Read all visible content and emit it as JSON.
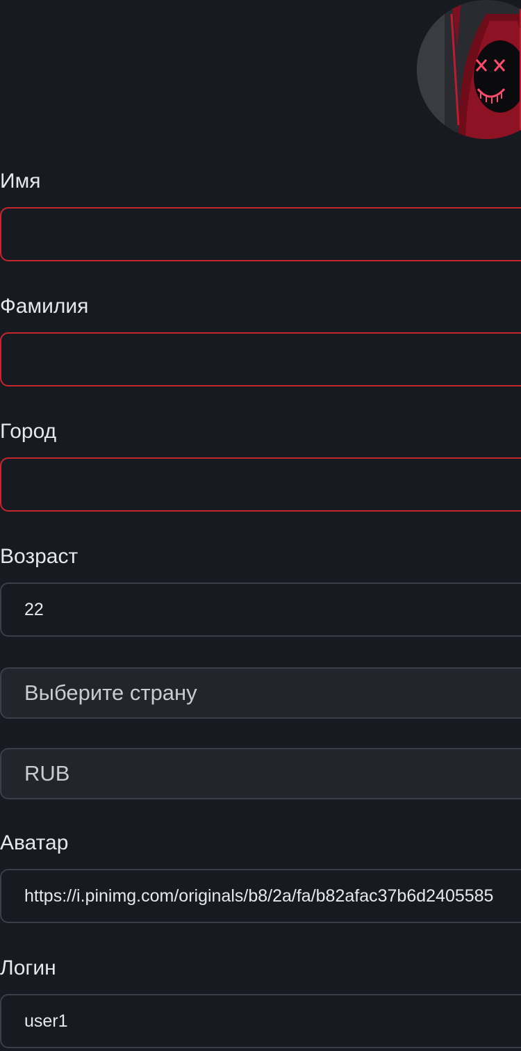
{
  "profile": {
    "avatar_alt": "avatar"
  },
  "form": {
    "first_name": {
      "label": "Имя",
      "value": ""
    },
    "last_name": {
      "label": "Фамилия",
      "value": ""
    },
    "city": {
      "label": "Город",
      "value": ""
    },
    "age": {
      "label": "Возраст",
      "value": "22"
    },
    "country": {
      "selected": "Выберите страну"
    },
    "currency": {
      "selected": "RUB"
    },
    "avatar_url": {
      "label": "Аватар",
      "value": "https://i.pinimg.com/originals/b8/2a/fa/b82afac37b6d2405585"
    },
    "login": {
      "label": "Логин",
      "value": "user1"
    }
  },
  "colors": {
    "background": "#171a20",
    "invalid_border": "#c4272f",
    "default_border": "#3a3e46",
    "select_background": "#22252c"
  }
}
